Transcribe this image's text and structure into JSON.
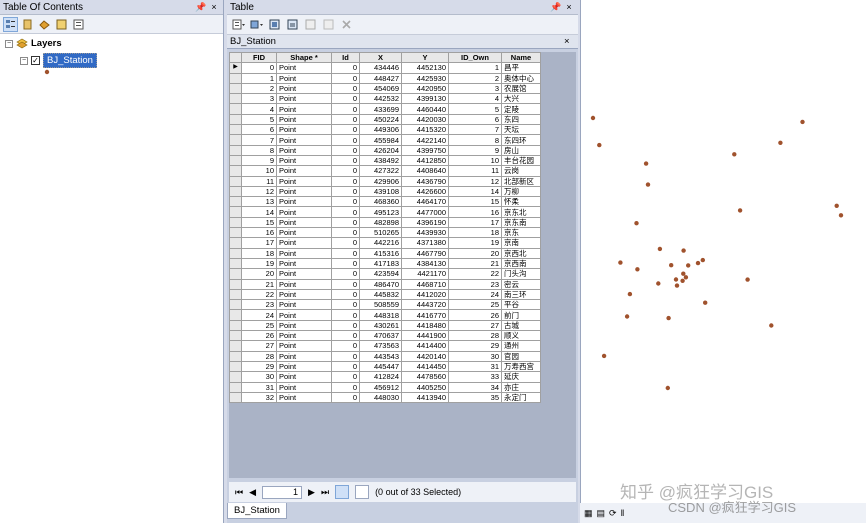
{
  "toc": {
    "title": "Table Of Contents",
    "pin": "―",
    "close": "×",
    "root_label": "Layers",
    "layer_label": "BJ_Station"
  },
  "table_window": {
    "title": "Table",
    "pin": "―",
    "close": "×",
    "tab_title": "BJ_Station",
    "tab_close": "×",
    "columns": [
      "FID",
      "Shape *",
      "Id",
      "X",
      "Y",
      "ID_Own",
      "Name"
    ],
    "rows": [
      [
        "0",
        "Point",
        "0",
        "434446",
        "4452130",
        "1",
        "昌平"
      ],
      [
        "1",
        "Point",
        "0",
        "448427",
        "4425930",
        "2",
        "奥体中心"
      ],
      [
        "2",
        "Point",
        "0",
        "454069",
        "4420950",
        "3",
        "农展馆"
      ],
      [
        "3",
        "Point",
        "0",
        "442532",
        "4399130",
        "4",
        "大兴"
      ],
      [
        "4",
        "Point",
        "0",
        "433699",
        "4460440",
        "5",
        "定陵"
      ],
      [
        "5",
        "Point",
        "0",
        "450224",
        "4420030",
        "6",
        "东四"
      ],
      [
        "6",
        "Point",
        "0",
        "449306",
        "4415320",
        "7",
        "天坛"
      ],
      [
        "7",
        "Point",
        "0",
        "455984",
        "4422140",
        "8",
        "东四环"
      ],
      [
        "8",
        "Point",
        "0",
        "426204",
        "4399750",
        "9",
        "房山"
      ],
      [
        "9",
        "Point",
        "0",
        "438492",
        "4412850",
        "10",
        "丰台花园"
      ],
      [
        "10",
        "Point",
        "0",
        "427322",
        "4408640",
        "11",
        "云岗"
      ],
      [
        "11",
        "Point",
        "0",
        "429906",
        "4436790",
        "12",
        "北部新区"
      ],
      [
        "12",
        "Point",
        "0",
        "439108",
        "4426600",
        "14",
        "万柳"
      ],
      [
        "13",
        "Point",
        "0",
        "468360",
        "4464170",
        "15",
        "怀柔"
      ],
      [
        "14",
        "Point",
        "0",
        "495123",
        "4477000",
        "16",
        "京东北"
      ],
      [
        "15",
        "Point",
        "0",
        "482898",
        "4396190",
        "17",
        "京东南"
      ],
      [
        "16",
        "Point",
        "0",
        "510265",
        "4439930",
        "18",
        "京东"
      ],
      [
        "17",
        "Point",
        "0",
        "442216",
        "4371380",
        "19",
        "京南"
      ],
      [
        "18",
        "Point",
        "0",
        "415316",
        "4467790",
        "20",
        "京西北"
      ],
      [
        "19",
        "Point",
        "0",
        "417183",
        "4384130",
        "21",
        "京西南"
      ],
      [
        "20",
        "Point",
        "0",
        "423594",
        "4421170",
        "22",
        "门头沟"
      ],
      [
        "21",
        "Point",
        "0",
        "486470",
        "4468710",
        "23",
        "密云"
      ],
      [
        "22",
        "Point",
        "0",
        "445832",
        "4412020",
        "24",
        "南三环"
      ],
      [
        "23",
        "Point",
        "0",
        "508559",
        "4443720",
        "25",
        "平谷"
      ],
      [
        "24",
        "Point",
        "0",
        "448318",
        "4416770",
        "26",
        "前门"
      ],
      [
        "25",
        "Point",
        "0",
        "430261",
        "4418480",
        "27",
        "古城"
      ],
      [
        "26",
        "Point",
        "0",
        "470637",
        "4441900",
        "28",
        "顺义"
      ],
      [
        "27",
        "Point",
        "0",
        "473563",
        "4414400",
        "29",
        "通州"
      ],
      [
        "28",
        "Point",
        "0",
        "443543",
        "4420140",
        "30",
        "官园"
      ],
      [
        "29",
        "Point",
        "0",
        "445447",
        "4414450",
        "31",
        "万寿西宫"
      ],
      [
        "30",
        "Point",
        "0",
        "412824",
        "4478560",
        "33",
        "延庆"
      ],
      [
        "31",
        "Point",
        "0",
        "456912",
        "4405250",
        "34",
        "亦庄"
      ],
      [
        "32",
        "Point",
        "0",
        "448030",
        "4413940",
        "35",
        "永定门"
      ]
    ],
    "record_value": "1",
    "selection_status": "(0 out of 33 Selected)",
    "bottom_tab": "BJ_Station"
  },
  "map_points": [
    [
      434446,
      4452130
    ],
    [
      448427,
      4425930
    ],
    [
      454069,
      4420950
    ],
    [
      442532,
      4399130
    ],
    [
      433699,
      4460440
    ],
    [
      450224,
      4420030
    ],
    [
      449306,
      4415320
    ],
    [
      455984,
      4422140
    ],
    [
      426204,
      4399750
    ],
    [
      438492,
      4412850
    ],
    [
      427322,
      4408640
    ],
    [
      429906,
      4436790
    ],
    [
      439108,
      4426600
    ],
    [
      468360,
      4464170
    ],
    [
      495123,
      4477000
    ],
    [
      482898,
      4396190
    ],
    [
      510265,
      4439930
    ],
    [
      442216,
      4371380
    ],
    [
      415316,
      4467790
    ],
    [
      417183,
      4384130
    ],
    [
      423594,
      4421170
    ],
    [
      486470,
      4468710
    ],
    [
      445832,
      4412020
    ],
    [
      508559,
      4443720
    ],
    [
      448318,
      4416770
    ],
    [
      430261,
      4418480
    ],
    [
      470637,
      4441900
    ],
    [
      473563,
      4414400
    ],
    [
      443543,
      4420140
    ],
    [
      445447,
      4414450
    ],
    [
      412824,
      4478560
    ],
    [
      456912,
      4405250
    ],
    [
      448030,
      4413940
    ]
  ],
  "watermark": "知乎 @疯狂学习GIS",
  "watermark_csdn": "CSDN @疯狂学习GIS",
  "colors": {
    "point_fill": "#a0522d",
    "selection": "#316ac5"
  }
}
